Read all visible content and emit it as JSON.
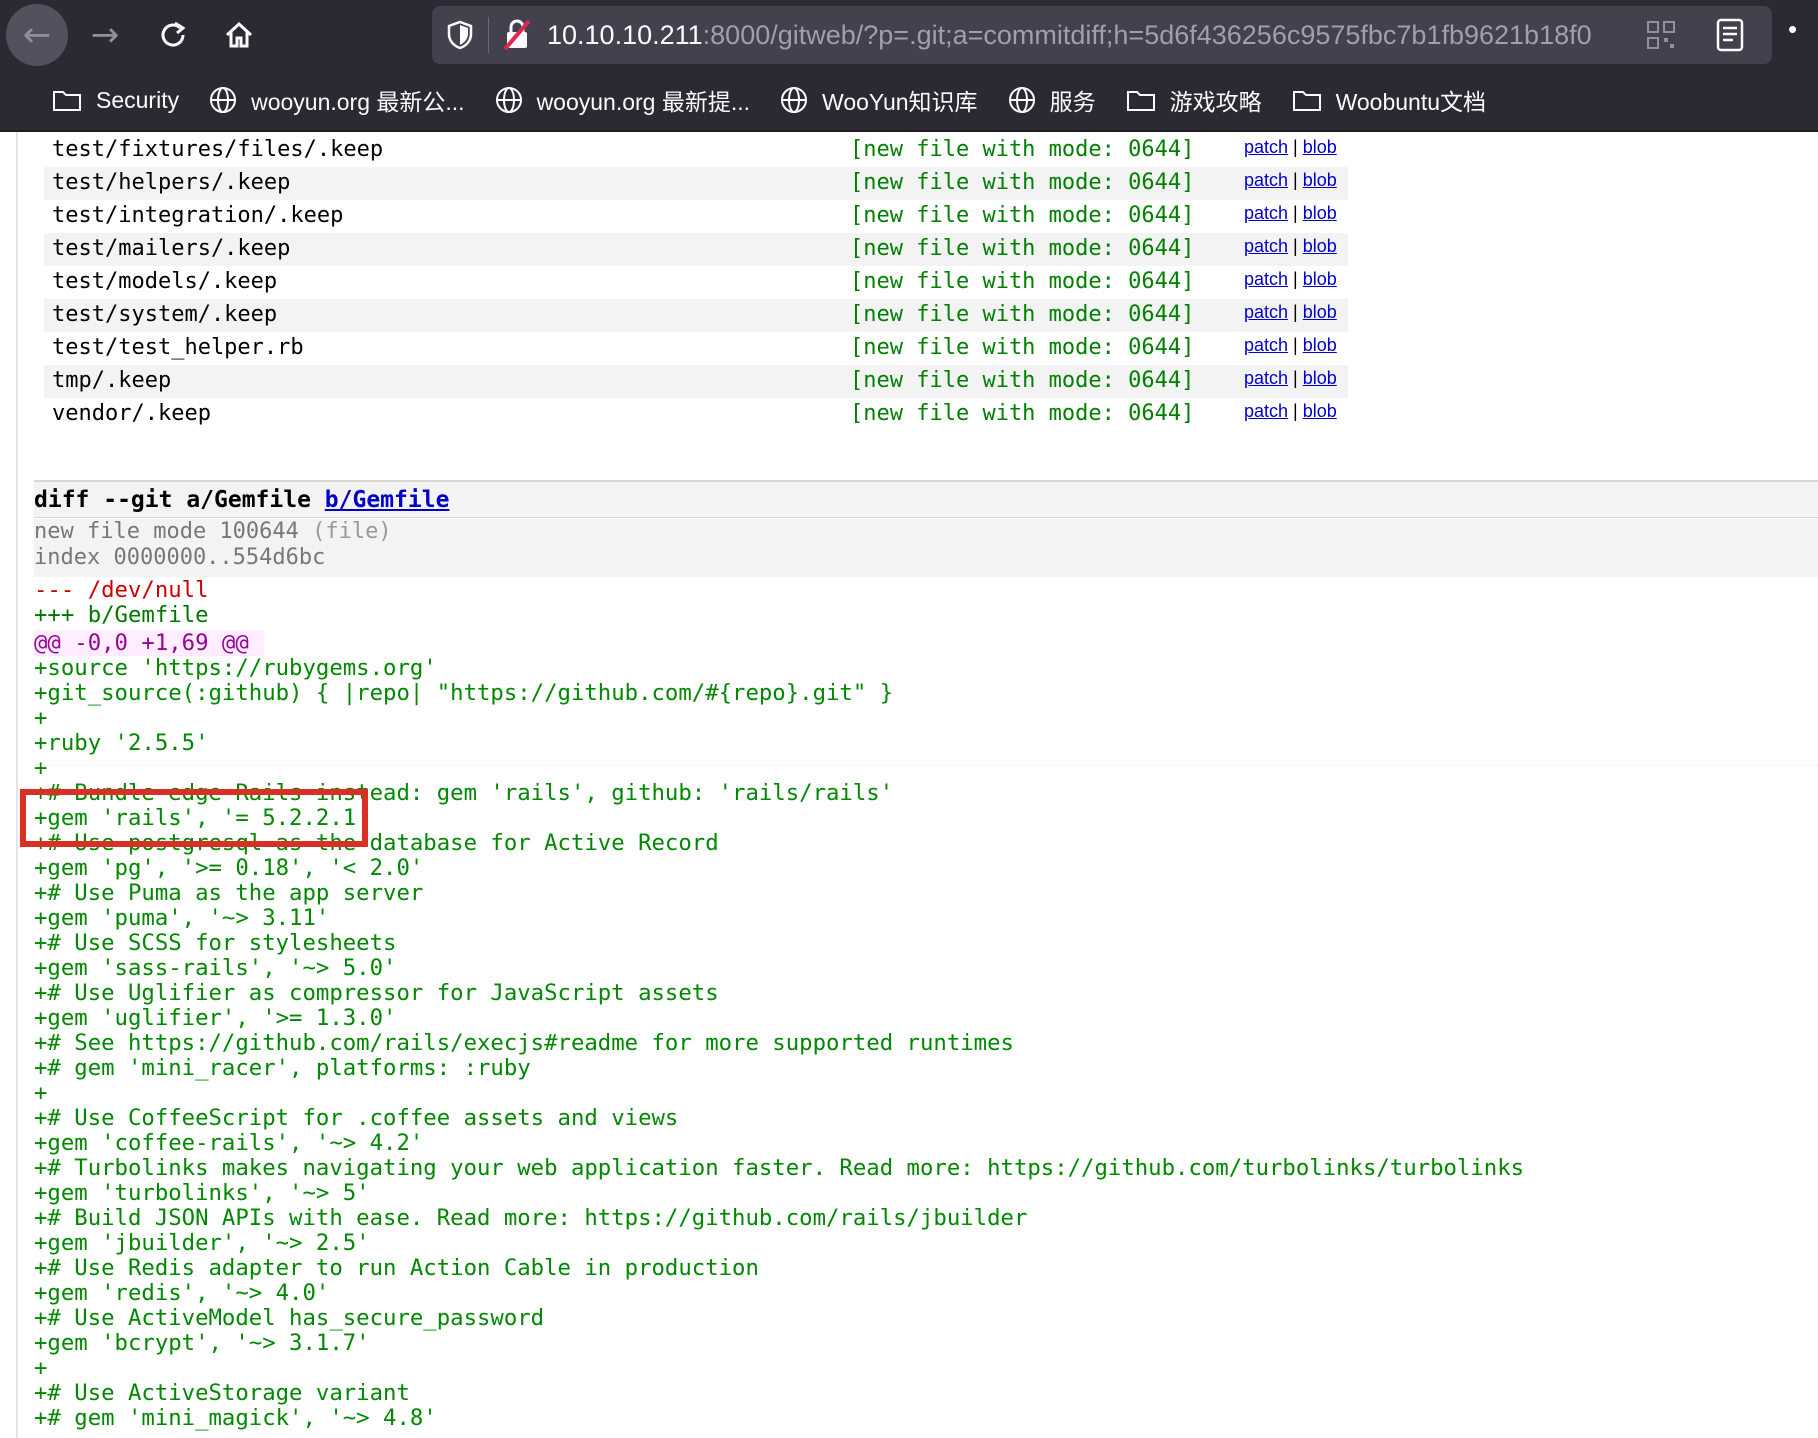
{
  "browser": {
    "url_host": "10.10.10.211",
    "url_rest": ":8000/gitweb/?p=.git;a=commitdiff;h=5d6f436256c9575fbc7b1fb9621b18f0",
    "bookmarks": [
      {
        "label": "Security",
        "icon": "folder-icon"
      },
      {
        "label": "wooyun.org 最新公...",
        "icon": "globe-icon"
      },
      {
        "label": "wooyun.org 最新提...",
        "icon": "globe-icon"
      },
      {
        "label": "WooYun知识库",
        "icon": "globe-icon"
      },
      {
        "label": "服务",
        "icon": "globe-icon"
      },
      {
        "label": "游戏攻略",
        "icon": "folder-icon"
      },
      {
        "label": "Woobuntu文档",
        "icon": "folder-icon"
      }
    ]
  },
  "tree": {
    "status": "[new file with mode: 0644]",
    "patch_label": "patch",
    "blob_label": "blob",
    "sep": " | ",
    "files": [
      "test/fixtures/files/.keep",
      "test/helpers/.keep",
      "test/integration/.keep",
      "test/mailers/.keep",
      "test/models/.keep",
      "test/system/.keep",
      "test/test_helper.rb",
      "tmp/.keep",
      "vendor/.keep"
    ]
  },
  "diff": {
    "header_prefix": "diff --git a/Gemfile ",
    "header_link": "b/Gemfile",
    "ext_mode": "new file mode 100644 ",
    "ext_mode_note": "(file)",
    "ext_index": "index 0000000..554d6bc",
    "from_file": "--- /dev/null",
    "to_file": "+++ b/Gemfile",
    "chunk_header": "@@ -0,0 +1,69 @@",
    "lines": [
      "+source 'https://rubygems.org'",
      "+git_source(:github) { |repo| \"https://github.com/#{repo}.git\" }",
      "+",
      "+ruby '2.5.5'",
      "+",
      "+# Bundle edge Rails instead: gem 'rails', github: 'rails/rails'",
      "+gem 'rails', '= 5.2.2.1'",
      "+# Use postgresql as the database for Active Record",
      "+gem 'pg', '>= 0.18', '< 2.0'",
      "+# Use Puma as the app server",
      "+gem 'puma', '~> 3.11'",
      "+# Use SCSS for stylesheets",
      "+gem 'sass-rails', '~> 5.0'",
      "+# Use Uglifier as compressor for JavaScript assets",
      "+gem 'uglifier', '>= 1.3.0'",
      "+# See https://github.com/rails/execjs#readme for more supported runtimes",
      "+# gem 'mini_racer', platforms: :ruby",
      "+",
      "+# Use CoffeeScript for .coffee assets and views",
      "+gem 'coffee-rails', '~> 4.2'",
      "+# Turbolinks makes navigating your web application faster. Read more: https://github.com/turbolinks/turbolinks",
      "+gem 'turbolinks', '~> 5'",
      "+# Build JSON APIs with ease. Read more: https://github.com/rails/jbuilder",
      "+gem 'jbuilder', '~> 2.5'",
      "+# Use Redis adapter to run Action Cable in production",
      "+gem 'redis', '~> 4.0'",
      "+# Use ActiveModel has_secure_password",
      "+gem 'bcrypt', '~> 3.1.7'",
      "+",
      "+# Use ActiveStorage variant",
      "+# gem 'mini_magick', '~> 4.8'"
    ]
  },
  "colors": {
    "highlight": "#d93025",
    "diff_add": "#008800",
    "diff_del": "#cc0000",
    "chunk": "#990099",
    "link": "#0000cc"
  }
}
